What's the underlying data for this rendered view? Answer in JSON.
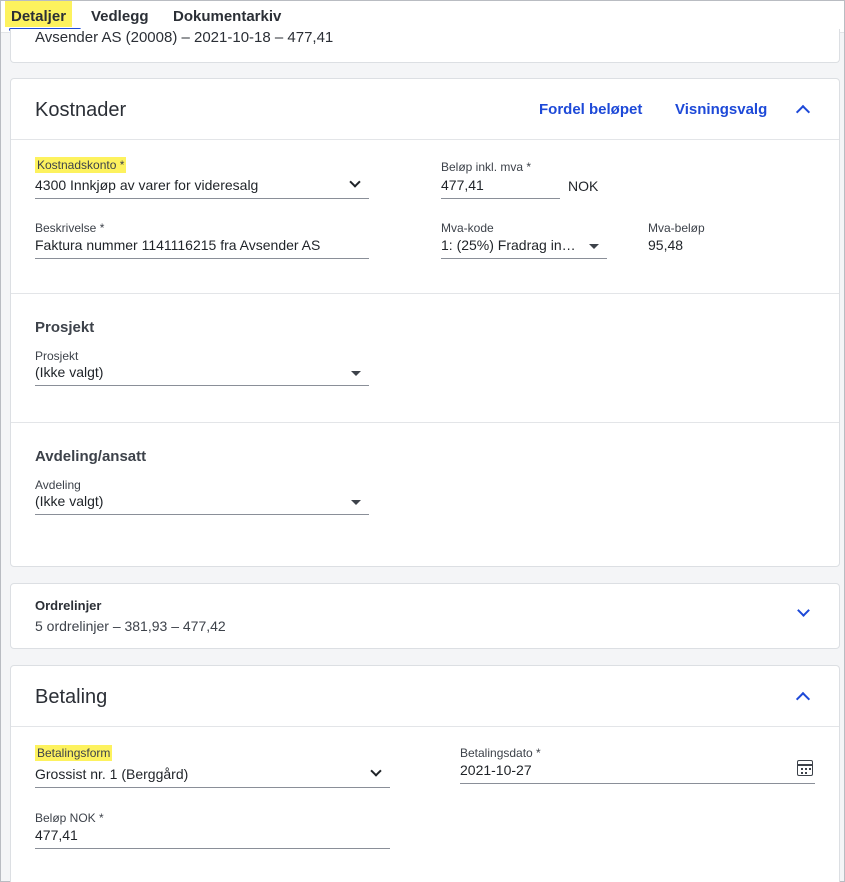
{
  "tabs": [
    {
      "label": "Detaljer",
      "active": true
    },
    {
      "label": "Vedlegg"
    },
    {
      "label": "Dokumentarkiv"
    }
  ],
  "top_card": {
    "text": "Avsender AS (20008) – 2021-10-18 – 477,41"
  },
  "kostnader": {
    "title": "Kostnader",
    "fordel_label": "Fordel beløpet",
    "visning_label": "Visningsvalg",
    "kostnadskonto": {
      "label": "Kostnadskonto *",
      "value": "4300 Innkjøp av varer for videresalg"
    },
    "belop": {
      "label": "Beløp inkl. mva *",
      "value": "477,41",
      "currency": "NOK"
    },
    "beskrivelse": {
      "label": "Beskrivelse *",
      "value": "Faktura nummer 1141116215 fra Avsender AS"
    },
    "mva_kode": {
      "label": "Mva-kode",
      "value": "1: (25%) Fradrag in…"
    },
    "mva_belop": {
      "label": "Mva-beløp",
      "value": "95,48"
    },
    "prosjekt": {
      "title": "Prosjekt",
      "label": "Prosjekt",
      "value": "(Ikke valgt)"
    },
    "avdeling": {
      "title": "Avdeling/ansatt",
      "label": "Avdeling",
      "value": "(Ikke valgt)"
    }
  },
  "ordrelinjer": {
    "title": "Ordrelinjer",
    "summary": "5 ordrelinjer  –  381,93  –  477,42"
  },
  "betaling": {
    "title": "Betaling",
    "betalingsform": {
      "label": "Betalingsform",
      "value": "Grossist nr. 1 (Berggård)"
    },
    "betalingsdato": {
      "label": "Betalingsdato *",
      "value": "2021-10-27"
    },
    "belop_nok": {
      "label": "Beløp NOK *",
      "value": "477,41"
    }
  },
  "colors": {
    "accent": "#1d49d8",
    "highlight": "#fdf25e"
  },
  "icons": [
    "chevron-up-icon",
    "chevron-down-icon",
    "caret-down-icon",
    "calendar-icon"
  ]
}
